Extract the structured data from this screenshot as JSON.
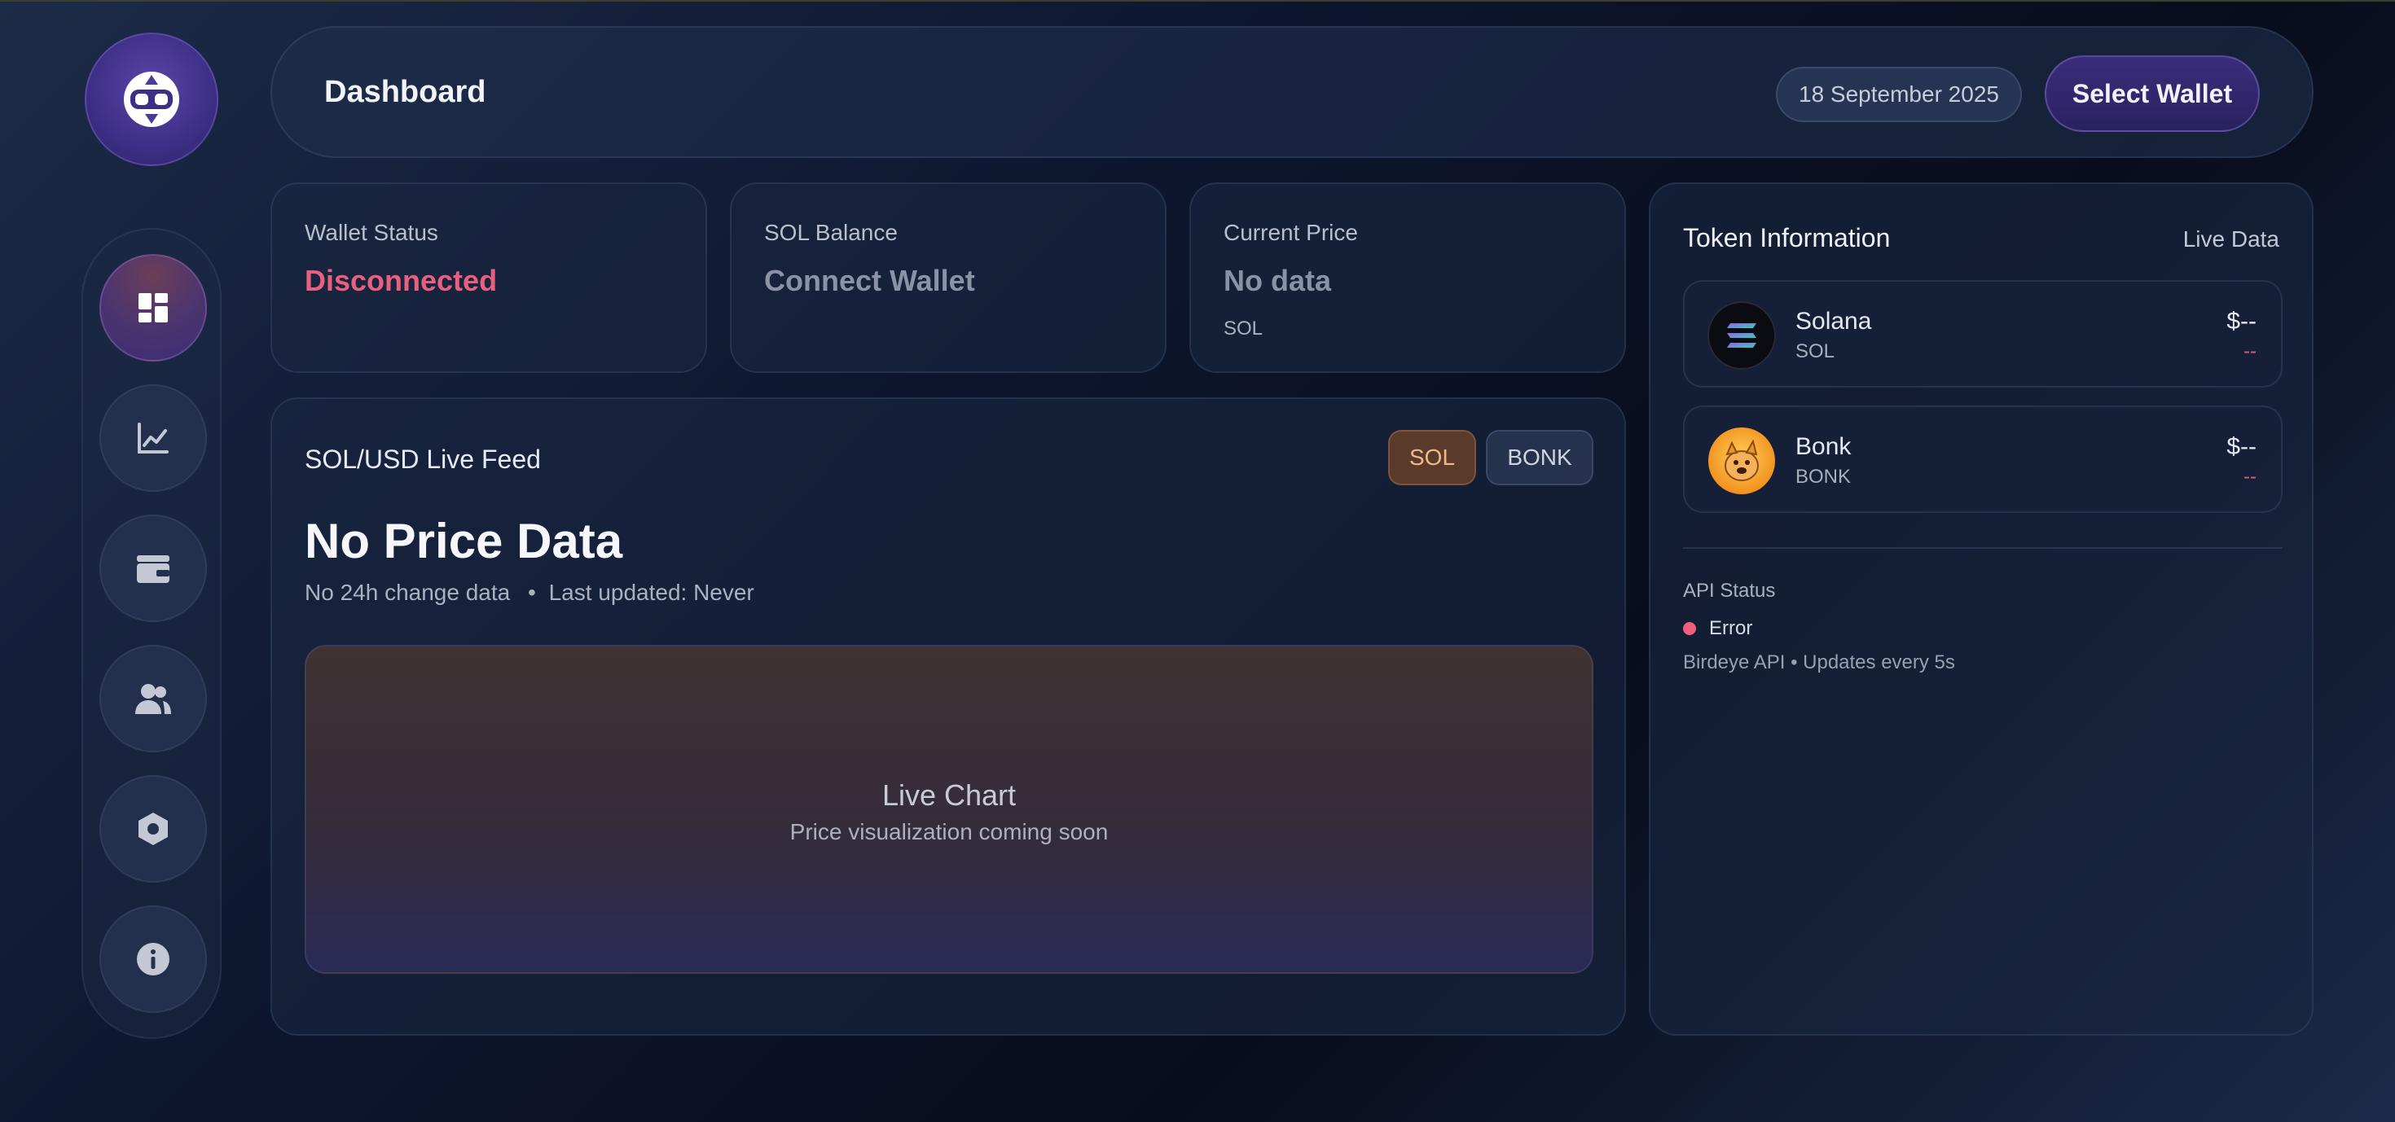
{
  "header": {
    "title": "Dashboard",
    "date": "18 September 2025",
    "select_wallet_label": "Select Wallet"
  },
  "sidebar": {
    "items": [
      {
        "icon": "dashboard-icon",
        "active": true
      },
      {
        "icon": "chart-icon",
        "active": false
      },
      {
        "icon": "wallet-icon",
        "active": false
      },
      {
        "icon": "users-icon",
        "active": false
      },
      {
        "icon": "settings-hex-icon",
        "active": false
      },
      {
        "icon": "info-icon",
        "active": false
      }
    ]
  },
  "stats": {
    "wallet_status": {
      "label": "Wallet Status",
      "value": "Disconnected",
      "color": "#e8607e"
    },
    "sol_balance": {
      "label": "SOL Balance",
      "value": "Connect Wallet",
      "color": "#8a93a6"
    },
    "current_price": {
      "label": "Current Price",
      "value": "No data",
      "sub": "SOL",
      "color": "#8a93a6"
    }
  },
  "feed": {
    "title": "SOL/USD Live Feed",
    "tokens": [
      "SOL",
      "BONK"
    ],
    "selected": "SOL",
    "price": "No Price Data",
    "change": "No 24h change data",
    "updated": "Last updated: Never",
    "chart_title": "Live Chart",
    "chart_sub": "Price visualization coming soon"
  },
  "token_info": {
    "title": "Token Information",
    "badge": "Live Data",
    "tokens": [
      {
        "name": "Solana",
        "symbol": "SOL",
        "price": "$--",
        "change": "--"
      },
      {
        "name": "Bonk",
        "symbol": "BONK",
        "price": "$--",
        "change": "--"
      }
    ],
    "api": {
      "label": "API Status",
      "state": "Error",
      "note": "Birdeye API • Updates every 5s",
      "state_color": "#f0607a"
    }
  }
}
